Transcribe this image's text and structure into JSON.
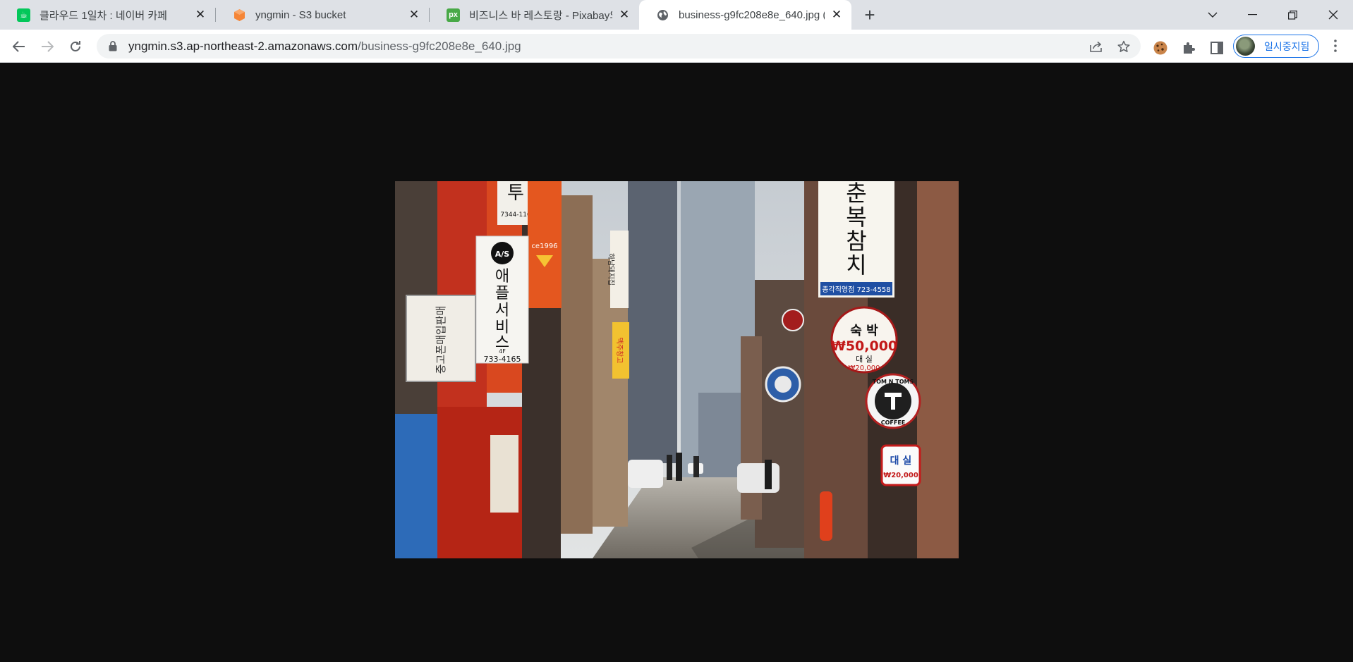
{
  "tabs": [
    {
      "title": "클라우드 1일차 : 네이버 카페",
      "favicon": "naver-cafe-icon",
      "active": false
    },
    {
      "title": "yngmin - S3 bucket",
      "favicon": "aws-s3-icon",
      "active": false
    },
    {
      "title": "비즈니스 바 레스토랑 - Pixabay의",
      "favicon": "pixabay-icon",
      "active": false
    },
    {
      "title": "business-g9fc208e8e_640.jpg (6",
      "favicon": "globe-icon",
      "active": true
    }
  ],
  "toolbar": {
    "url_host": "yngmin.s3.ap-northeast-2.amazonaws.com",
    "url_path": "/business-g9fc208e8e_640.jpg",
    "profile_label": "일시중지됨"
  },
  "image": {
    "signs": {
      "apple_top": "A/S",
      "apple_v1": "애",
      "apple_v2": "플",
      "apple_v3": "서",
      "apple_v4": "비",
      "apple_v5": "스",
      "apple_floor": "4F",
      "apple_phone": "733-4165",
      "top_left_phone": "7344-116",
      "orange_since": "ce1996",
      "used_sign": "중고폰매입판매",
      "hotel_v1": "춘",
      "hotel_v2": "복",
      "hotel_v3": "참",
      "hotel_v4": "치",
      "hotel_phone": "종각직영점 723-4558",
      "stay_title": "숙 박",
      "stay_price": "₩50,000",
      "stay_rent": "대 실",
      "stay_rent_price": "₩20,000",
      "tomntoms_1": "TOM N TOMS",
      "tomntoms_2": "COFFEE",
      "rent_sign": "대 실",
      "rent_sign_price": "₩20,000",
      "beer_sign": "맥주창고",
      "hanam_sign": "하남돼지집"
    }
  }
}
